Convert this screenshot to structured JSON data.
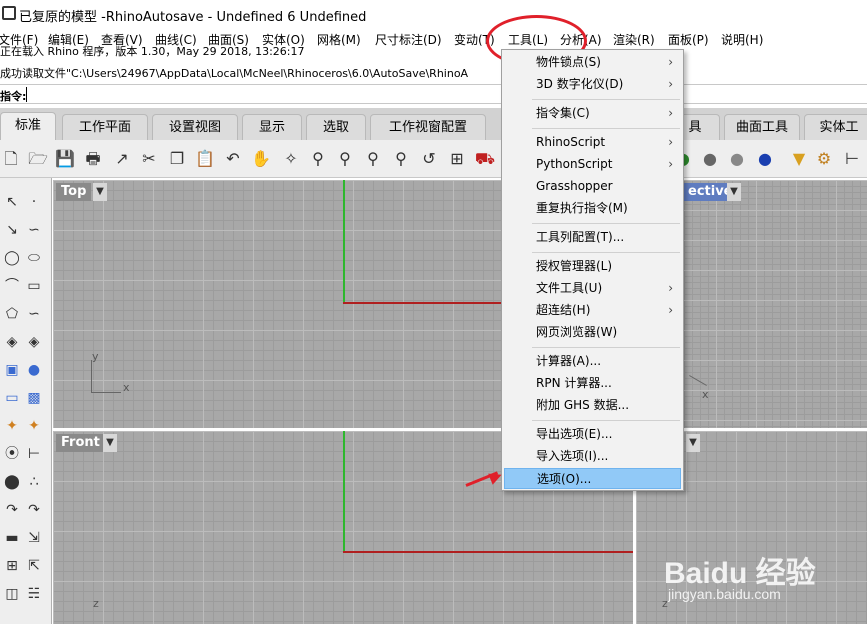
{
  "window": {
    "title": "已复原的模型 -RhinoAutosave - Undefined 6 Undefined"
  },
  "menubar": {
    "items": [
      "文件(F)",
      "编辑(E)",
      "查看(V)",
      "曲线(C)",
      "曲面(S)",
      "实体(O)",
      "网格(M)",
      "尺寸标注(D)",
      "变动(T)",
      "工具(L)",
      "分析(A)",
      "渲染(R)",
      "面板(P)",
      "说明(H)"
    ]
  },
  "command": {
    "history": [
      "正在载入 Rhino 程序，版本 1.30，May 29 2018, 13:26:17",
      "成功读取文件\"C:\\Users\\24967\\AppData\\Local\\McNeel\\Rhinoceros\\6.0\\AutoSave\\RhinoA"
    ],
    "prompt_label": "指令:",
    "input_value": ""
  },
  "tabs": [
    "标准",
    "工作平面",
    "设置视图",
    "显示",
    "选取",
    "工作视窗配置",
    "具",
    "曲面工具",
    "实体工"
  ],
  "toolbar_icons": [
    "new-file-icon",
    "open-folder-icon",
    "save-icon",
    "print-icon",
    "import-icon",
    "cut-icon",
    "copy-icon",
    "paste-icon",
    "undo-icon",
    "pan-hand-icon",
    "rotate-view-icon",
    "zoom-icon",
    "zoom-window-icon",
    "zoom-extents-icon",
    "zoom-selected-icon",
    "undo-view-icon",
    "grid-four-viewports-icon",
    "car-icon",
    "shaded-sphere-icon",
    "wireframe-sphere-icon",
    "ghosted-sphere-icon",
    "blue-sphere-icon",
    "light-icon",
    "gear-settings-icon",
    "snap-grid-icon"
  ],
  "viewports": {
    "top": {
      "label": "Top",
      "axis_y": "y",
      "axis_x": "x"
    },
    "perspective": {
      "label": "ective"
    },
    "front": {
      "label": "Front",
      "axis_z": "z"
    }
  },
  "dropdown": {
    "items": [
      {
        "label": "物件锁点(S)",
        "submenu": true
      },
      {
        "label": "3D 数字化仪(D)",
        "submenu": true
      },
      {
        "label": "指令集(C)",
        "submenu": true
      },
      {
        "label": "RhinoScript",
        "submenu": true
      },
      {
        "label": "PythonScript",
        "submenu": true
      },
      {
        "label": "Grasshopper",
        "submenu": false
      },
      {
        "label": "重复执行指令(M)",
        "submenu": false
      },
      {
        "label": "工具列配置(T)...",
        "submenu": false
      },
      {
        "label": "授权管理器(L)",
        "submenu": false
      },
      {
        "label": "文件工具(U)",
        "submenu": true
      },
      {
        "label": "超连结(H)",
        "submenu": true
      },
      {
        "label": "网页浏览器(W)",
        "submenu": false
      },
      {
        "label": "计算器(A)...",
        "submenu": false
      },
      {
        "label": "RPN 计算器...",
        "submenu": false
      },
      {
        "label": "附加 GHS 数据...",
        "submenu": false
      },
      {
        "label": "导出选项(E)...",
        "submenu": false
      },
      {
        "label": "导入选项(I)...",
        "submenu": false
      },
      {
        "label": "选项(O)...",
        "submenu": false,
        "highlighted": true
      }
    ],
    "submenu_glyph": "›"
  },
  "watermark": {
    "brand": "Baidu 经验",
    "url": "jingyan.baidu.com"
  },
  "colors": {
    "accent_annotation": "#e0202a",
    "menu_highlight": "#91c9f7",
    "viewport_bg": "#a8a8a8"
  }
}
